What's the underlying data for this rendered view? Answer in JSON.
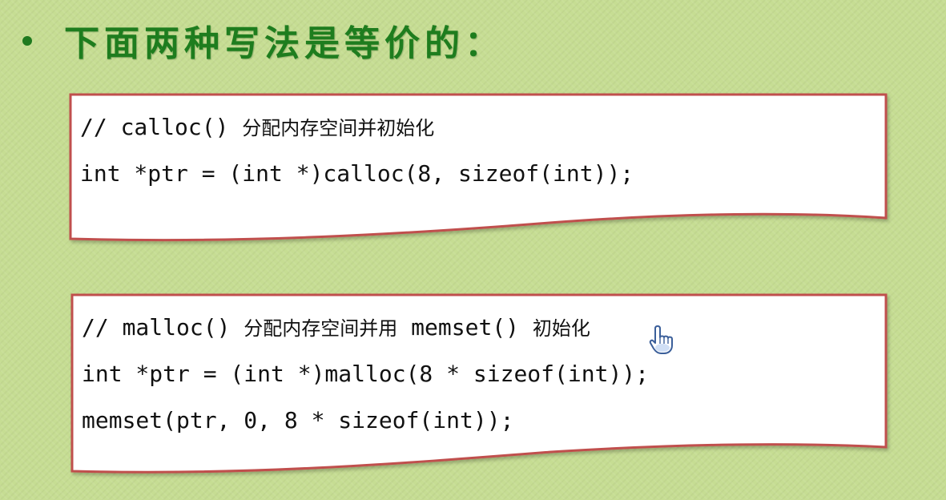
{
  "heading": {
    "bullet": "•",
    "text": "下面两种写法是等价的："
  },
  "blocks": [
    {
      "comment": "// calloc() ",
      "comment_cn": "分配内存空间并初始化",
      "lines": [
        "int *ptr = (int *)calloc(8, sizeof(int));"
      ]
    },
    {
      "comment": "// malloc() ",
      "comment_cn": "分配内存空间并用",
      "comment_mid": " memset() ",
      "comment_cn2": "初始化",
      "lines": [
        "int *ptr = (int *)malloc(8 * sizeof(int));",
        "memset(ptr, 0, 8 * sizeof(int));"
      ]
    }
  ],
  "colors": {
    "background": "#c6dd93",
    "heading": "#1e7d1e",
    "box_border": "#c0504d",
    "box_fill": "#ffffff"
  },
  "icons": {
    "cursor": "hand-pointer-icon"
  }
}
